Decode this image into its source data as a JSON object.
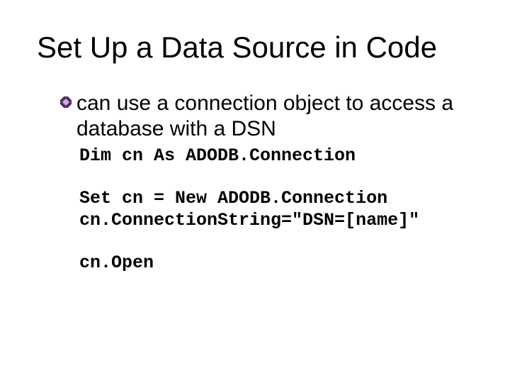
{
  "title": "Set Up a Data Source in Code",
  "bullet": {
    "text": "can use a connection object to access a database with a DSN"
  },
  "code": {
    "line1": "Dim cn As ADODB.Connection",
    "line2": "Set cn = New ADODB.Connection",
    "line3": "cn.ConnectionString=\"DSN=[name]\"",
    "line4": "cn.Open"
  }
}
